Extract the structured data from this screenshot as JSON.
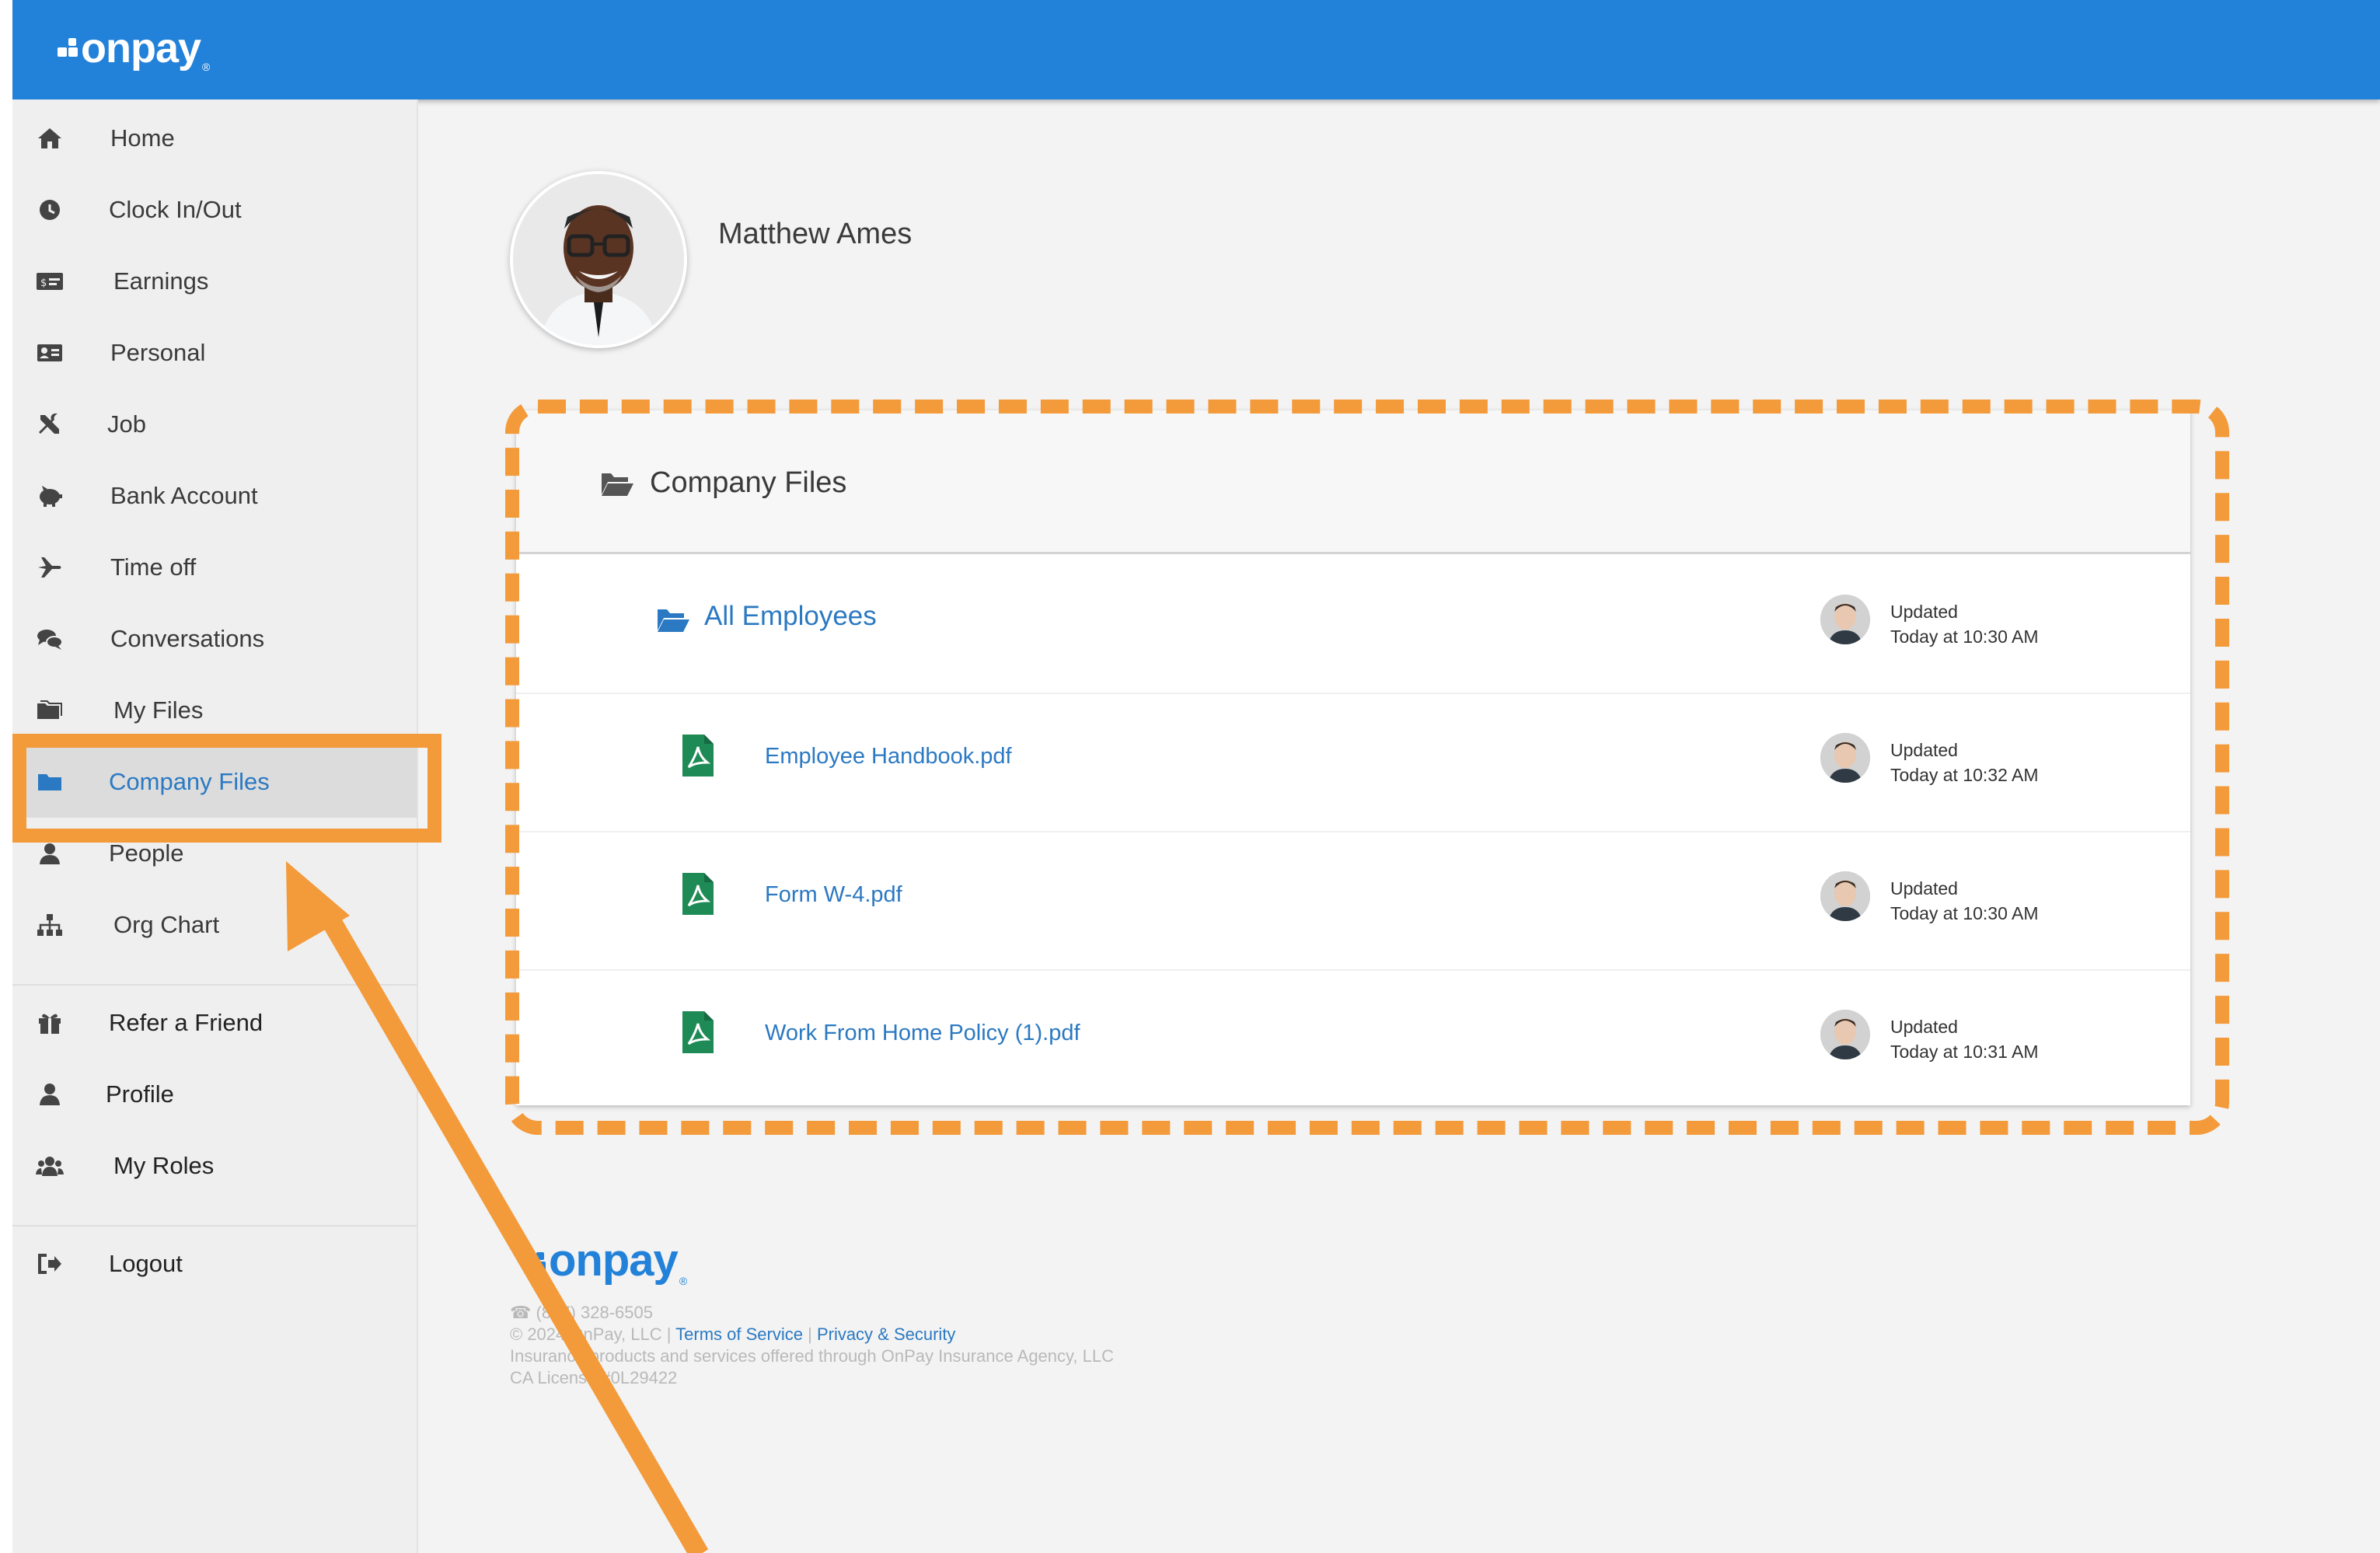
{
  "brand": {
    "logo_text": "onpay",
    "registered": "®"
  },
  "sidebar": {
    "items": [
      {
        "label": "Home",
        "icon": "home-icon"
      },
      {
        "label": "Clock In/Out",
        "icon": "clock-icon"
      },
      {
        "label": "Earnings",
        "icon": "money-icon"
      },
      {
        "label": "Personal",
        "icon": "id-card-icon"
      },
      {
        "label": "Job",
        "icon": "tools-icon"
      },
      {
        "label": "Bank Account",
        "icon": "piggy-bank-icon"
      },
      {
        "label": "Time off",
        "icon": "plane-icon"
      },
      {
        "label": "Conversations",
        "icon": "chat-icon"
      },
      {
        "label": "My Files",
        "icon": "files-icon"
      },
      {
        "label": "Company Files",
        "icon": "folder-icon",
        "active": true
      },
      {
        "label": "People",
        "icon": "person-icon"
      },
      {
        "label": "Org Chart",
        "icon": "org-chart-icon"
      }
    ],
    "secondary": [
      {
        "label": "Refer a Friend",
        "icon": "gift-icon"
      },
      {
        "label": "Profile",
        "icon": "user-icon"
      },
      {
        "label": "My Roles",
        "icon": "users-icon"
      }
    ],
    "logout": {
      "label": "Logout",
      "icon": "sign-out-icon"
    }
  },
  "profile": {
    "name": "Matthew Ames"
  },
  "company_files": {
    "title": "Company Files",
    "folder": {
      "name": "All Employees",
      "updated_label": "Updated",
      "updated_time": "Today at 10:30 AM"
    },
    "files": [
      {
        "name": "Employee Handbook.pdf",
        "updated_label": "Updated",
        "updated_time": "Today at 10:32 AM"
      },
      {
        "name": "Form W-4.pdf",
        "updated_label": "Updated",
        "updated_time": "Today at 10:30 AM"
      },
      {
        "name": "Work From Home Policy (1).pdf",
        "updated_label": "Updated",
        "updated_time": "Today at 10:31 AM"
      }
    ]
  },
  "footer": {
    "phone": "(877) 328-6505",
    "copyright": "© 2024 OnPay, LLC |",
    "terms": "Terms of Service",
    "separator": "|",
    "privacy": "Privacy & Security",
    "insurance": "Insurance products and services offered through OnPay Insurance Agency, LLC",
    "license": "CA License #0L29422"
  },
  "colors": {
    "brand_blue": "#2281d8",
    "link_blue": "#2b79c2",
    "annotation_orange": "#f39a3a",
    "pdf_green": "#1e8a55"
  }
}
